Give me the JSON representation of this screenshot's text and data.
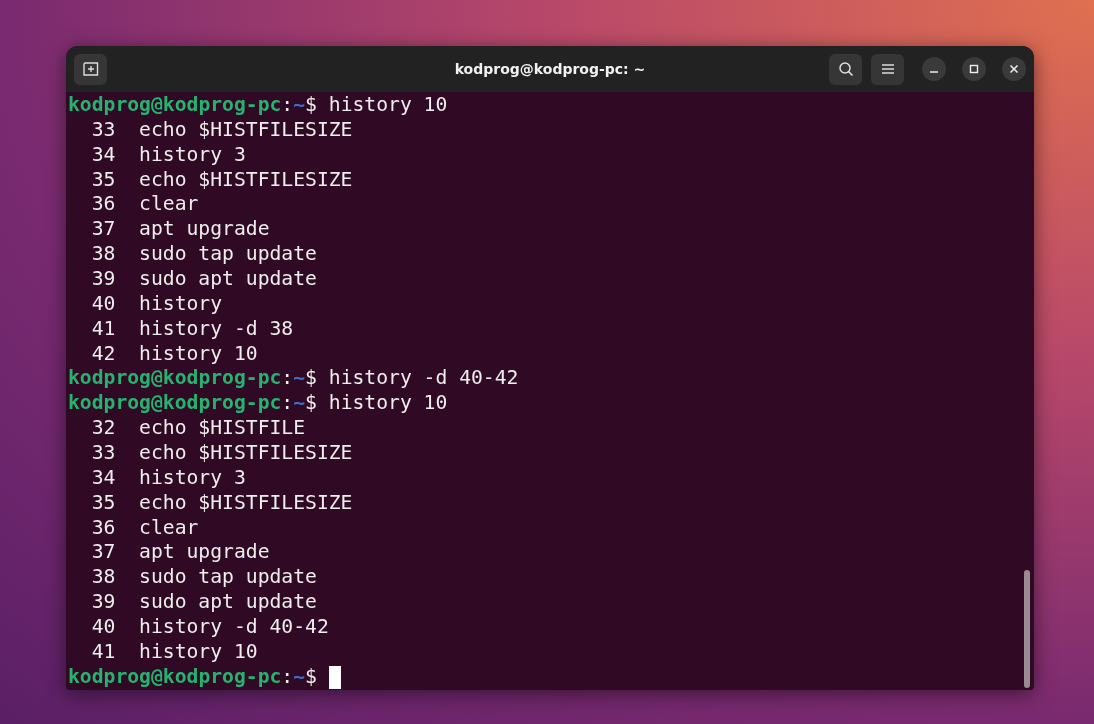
{
  "window": {
    "title": "kodprog@kodprog-pc: ~"
  },
  "terminal": {
    "lines": [
      {
        "kind": "prompt",
        "user_host": "kodprog@kodprog-pc",
        "separator": ":",
        "path": "~",
        "symbol": "$",
        "command": "history 10",
        "cursor": false
      },
      {
        "kind": "output",
        "number": "33",
        "text": "echo $HISTFILESIZE"
      },
      {
        "kind": "output",
        "number": "34",
        "text": "history 3"
      },
      {
        "kind": "output",
        "number": "35",
        "text": "echo $HISTFILESIZE"
      },
      {
        "kind": "output",
        "number": "36",
        "text": "clear"
      },
      {
        "kind": "output",
        "number": "37",
        "text": "apt upgrade"
      },
      {
        "kind": "output",
        "number": "38",
        "text": "sudo tap update"
      },
      {
        "kind": "output",
        "number": "39",
        "text": "sudo apt update"
      },
      {
        "kind": "output",
        "number": "40",
        "text": "history"
      },
      {
        "kind": "output",
        "number": "41",
        "text": "history -d 38"
      },
      {
        "kind": "output",
        "number": "42",
        "text": "history 10"
      },
      {
        "kind": "prompt",
        "user_host": "kodprog@kodprog-pc",
        "separator": ":",
        "path": "~",
        "symbol": "$",
        "command": "history -d 40-42",
        "cursor": false
      },
      {
        "kind": "prompt",
        "user_host": "kodprog@kodprog-pc",
        "separator": ":",
        "path": "~",
        "symbol": "$",
        "command": "history 10",
        "cursor": false
      },
      {
        "kind": "output",
        "number": "32",
        "text": "echo $HISTFILE"
      },
      {
        "kind": "output",
        "number": "33",
        "text": "echo $HISTFILESIZE"
      },
      {
        "kind": "output",
        "number": "34",
        "text": "history 3"
      },
      {
        "kind": "output",
        "number": "35",
        "text": "echo $HISTFILESIZE"
      },
      {
        "kind": "output",
        "number": "36",
        "text": "clear"
      },
      {
        "kind": "output",
        "number": "37",
        "text": "apt upgrade"
      },
      {
        "kind": "output",
        "number": "38",
        "text": "sudo tap update"
      },
      {
        "kind": "output",
        "number": "39",
        "text": "sudo apt update"
      },
      {
        "kind": "output",
        "number": "40",
        "text": "history -d 40-42"
      },
      {
        "kind": "output",
        "number": "41",
        "text": "history 10"
      },
      {
        "kind": "prompt",
        "user_host": "kodprog@kodprog-pc",
        "separator": ":",
        "path": "~",
        "symbol": "$",
        "cursor": true
      }
    ]
  }
}
